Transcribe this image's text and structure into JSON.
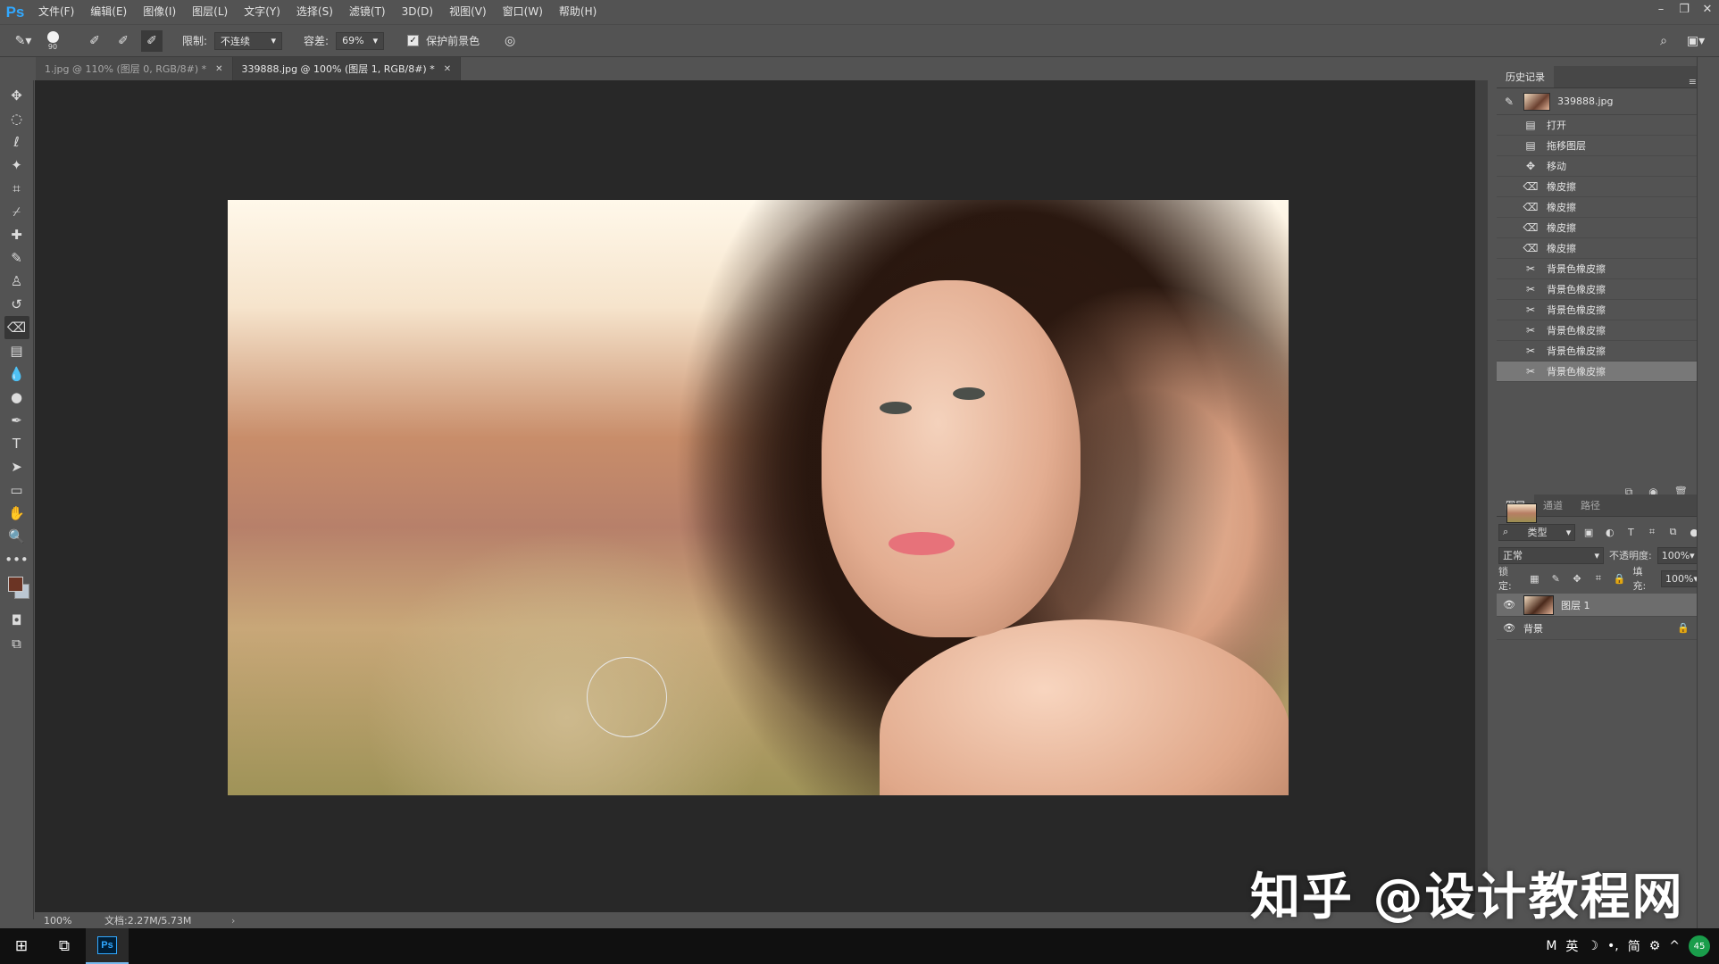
{
  "app": {
    "logo": "Ps",
    "menu": [
      "文件(F)",
      "编辑(E)",
      "图像(I)",
      "图层(L)",
      "文字(Y)",
      "选择(S)",
      "滤镜(T)",
      "3D(D)",
      "视图(V)",
      "窗口(W)",
      "帮助(H)"
    ]
  },
  "options": {
    "brush_size": "90",
    "limit_label": "限制:",
    "limit_value": "不连续",
    "tolerance_label": "容差:",
    "tolerance_value": "69%",
    "protect_label": "保护前景色",
    "protect_checked": true
  },
  "tabs": [
    {
      "label": "1.jpg @ 110% (图层 0, RGB/8#) *",
      "active": false
    },
    {
      "label": "339888.jpg @ 100% (图层 1, RGB/8#) *",
      "active": true
    }
  ],
  "status": {
    "zoom": "100%",
    "doc": "文档:2.27M/5.73M"
  },
  "history": {
    "tab_label": "历史记录",
    "snapshot_label": "339888.jpg",
    "items": [
      {
        "label": "打开",
        "icon": "document-icon"
      },
      {
        "label": "拖移图层",
        "icon": "document-icon"
      },
      {
        "label": "移动",
        "icon": "move-icon"
      },
      {
        "label": "橡皮擦",
        "icon": "eraser-icon"
      },
      {
        "label": "橡皮擦",
        "icon": "eraser-icon"
      },
      {
        "label": "橡皮擦",
        "icon": "eraser-icon"
      },
      {
        "label": "橡皮擦",
        "icon": "eraser-icon"
      },
      {
        "label": "背景色橡皮擦",
        "icon": "bg-eraser-icon"
      },
      {
        "label": "背景色橡皮擦",
        "icon": "bg-eraser-icon"
      },
      {
        "label": "背景色橡皮擦",
        "icon": "bg-eraser-icon"
      },
      {
        "label": "背景色橡皮擦",
        "icon": "bg-eraser-icon"
      },
      {
        "label": "背景色橡皮擦",
        "icon": "bg-eraser-icon"
      },
      {
        "label": "背景色橡皮擦",
        "icon": "bg-eraser-icon"
      }
    ]
  },
  "layers": {
    "tabs": [
      "图层",
      "通道",
      "路径"
    ],
    "filter_label": "类型",
    "blend_mode": "正常",
    "opacity_label": "不透明度:",
    "opacity_value": "100%",
    "lock_label": "锁定:",
    "fill_label": "填充:",
    "fill_value": "100%",
    "items": [
      {
        "name": "图层 1",
        "selected": true
      },
      {
        "name": "背景",
        "selected": false
      }
    ]
  },
  "watermark": "知乎 @设计教程网",
  "taskbar": {
    "tray": [
      "M",
      "英",
      "简"
    ],
    "badge": "45"
  },
  "colors": {
    "foreground": "#6b3424",
    "background": "#bcc7d2",
    "accent": "#31a8ff"
  }
}
